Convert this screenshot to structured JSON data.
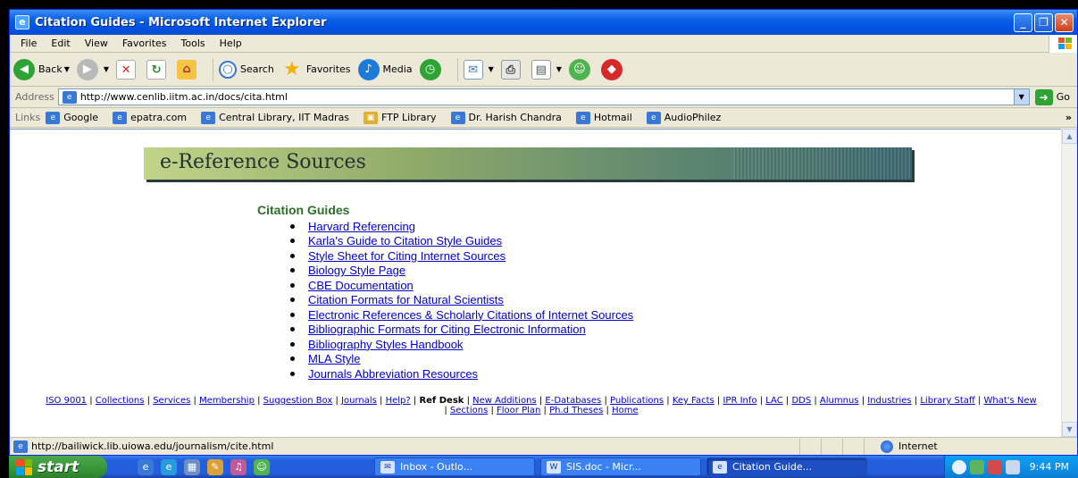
{
  "window": {
    "title": "Citation Guides - Microsoft Internet Explorer",
    "minimize": "_",
    "restore": "❐",
    "close": "✕"
  },
  "menu": [
    "File",
    "Edit",
    "View",
    "Favorites",
    "Tools",
    "Help"
  ],
  "toolbar": {
    "back": "Back",
    "search": "Search",
    "favorites": "Favorites",
    "media": "Media"
  },
  "address": {
    "label": "Address",
    "url": "http://www.cenlib.iitm.ac.in/docs/cita.html",
    "go": "Go"
  },
  "links": {
    "label": "Links",
    "items": [
      "Google",
      "epatra.com",
      "Central Library, IIT Madras",
      "FTP Library",
      "Dr. Harish Chandra",
      "Hotmail",
      "AudioPhilez"
    ],
    "more": "»"
  },
  "page": {
    "banner": "e-Reference Sources",
    "heading": "Citation Guides",
    "guides": [
      "Harvard Referencing",
      "Karla's Guide to Citation Style Guides",
      "Style Sheet for Citing Internet Sources",
      "Biology Style Page",
      "CBE Documentation",
      "Citation Formats for Natural Scientists",
      "Electronic References & Scholarly Citations of Internet Sources",
      "Bibliographic Formats for Citing Electronic Information",
      "Bibliography Styles Handbook",
      "MLA Style",
      "Journals Abbreviation Resources"
    ],
    "footer_links": {
      "iso": "ISO 9001",
      "collections": "Collections",
      "services": "Services",
      "membership": "Membership",
      "suggestion": "Suggestion Box",
      "journals": "Journals",
      "help": "Help?",
      "refdesk": "Ref Desk",
      "newadd": "New Additions",
      "edb": "E-Databases",
      "publications": "Publications",
      "keyfacts": "Key Facts",
      "ipr": "IPR Info",
      "lac": "LAC",
      "dds": "DDS",
      "alumnus": "Alumnus",
      "industries": "Industries",
      "libstaff": "Library Staff",
      "whatsnew": "What's New",
      "sections": "Sections",
      "floorplan": "Floor Plan",
      "phd": "Ph.d Theses",
      "home": "Home"
    }
  },
  "status": {
    "url": "http://bailiwick.lib.uiowa.edu/journalism/cite.html",
    "zone": "Internet"
  },
  "taskbar": {
    "start": "start",
    "tasks": [
      "Inbox - Outlo...",
      "SIS.doc - Micr...",
      "Citation Guide..."
    ],
    "clock": "9:44 PM"
  },
  "colors": {
    "heading": "#2e6f2c",
    "link": "#0000cc",
    "title_bar": "#0054e3",
    "start_button": "#3a9a3a"
  }
}
